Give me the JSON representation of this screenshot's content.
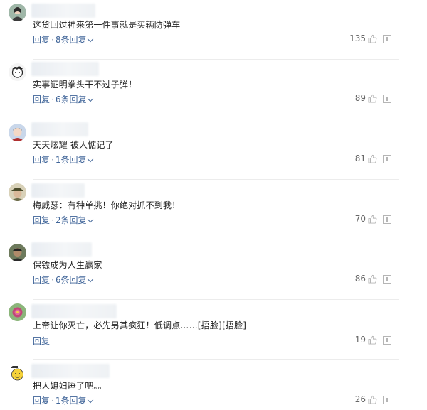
{
  "comments": [
    {
      "text": "这货回过神来第一件事就是买辆防弹车",
      "reply": "回复",
      "sep": "·",
      "sub": "8条回复",
      "likes": "135",
      "avatar": "girl"
    },
    {
      "text": "实事证明拳头干不过子弹！",
      "reply": "回复",
      "sep": "·",
      "sub": "6条回复",
      "likes": "89",
      "avatar": "cartoon"
    },
    {
      "text": "天天炫耀 被人惦记了",
      "reply": "回复",
      "sep": "·",
      "sub": "1条回复",
      "likes": "81",
      "avatar": "kid"
    },
    {
      "text": "梅威瑟：有种单挑！你绝对抓不到我！",
      "reply": "回复",
      "sep": "·",
      "sub": "2条回复",
      "likes": "70",
      "avatar": "man-hat"
    },
    {
      "text": "保镖成为人生赢家",
      "reply": "回复",
      "sep": "·",
      "sub": "6条回复",
      "likes": "86",
      "avatar": "man-dark"
    },
    {
      "text": "上帝让你灭亡，必先另其疯狂！低调点……[捂脸][捂脸]",
      "reply": "回复",
      "sep": "",
      "sub": "",
      "likes": "19",
      "avatar": "flower"
    },
    {
      "text": "把人媳妇睡了吧。。",
      "reply": "回复",
      "sep": "·",
      "sub": "1条回复",
      "likes": "26",
      "avatar": "sticker"
    }
  ],
  "colors": {
    "link": "#406599",
    "text": "#222222",
    "count": "#666666",
    "divider": "#ececec"
  },
  "icons": {
    "like": "thumbs-up-icon",
    "report": "report-icon",
    "expand": "chevron-down-icon"
  }
}
